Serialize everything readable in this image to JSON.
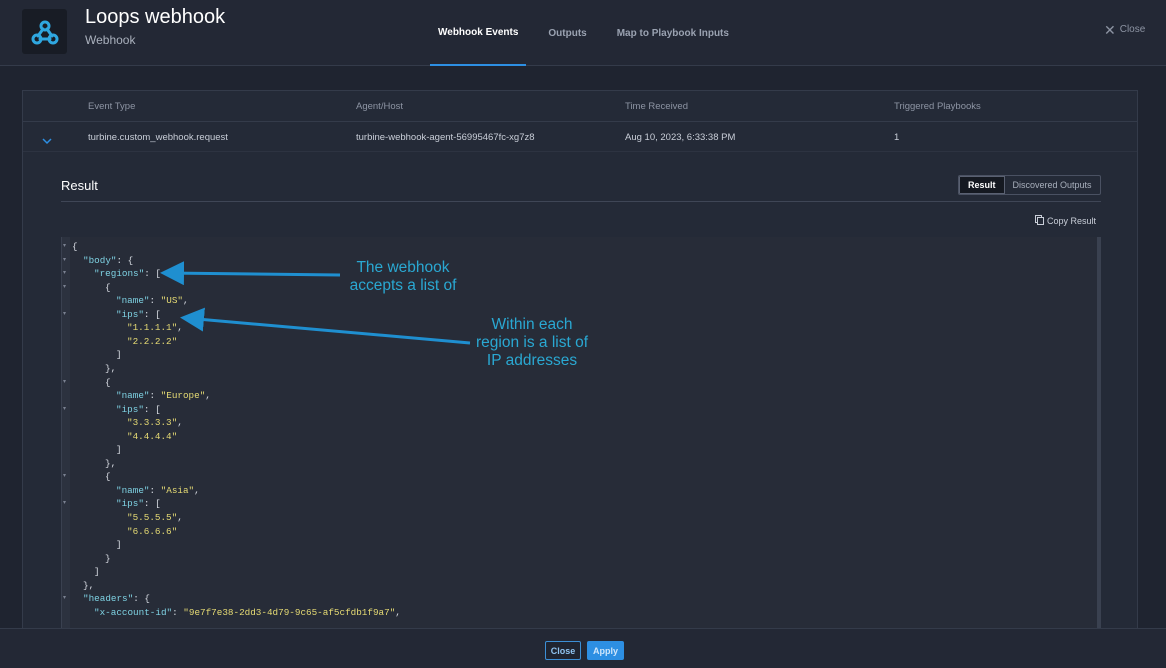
{
  "header": {
    "title": "Loops webhook",
    "subtitle": "Webhook",
    "icon": "webhook-icon",
    "tabs": [
      "Webhook Events",
      "Outputs",
      "Map to Playbook Inputs"
    ],
    "close_label": "Close"
  },
  "table": {
    "columns": [
      "Event Type",
      "Agent/Host",
      "Time Received",
      "Triggered Playbooks"
    ],
    "rows": [
      {
        "event_type": "turbine.custom_webhook.request",
        "agent_host": "turbine-webhook-agent-56995467fc-xg7z8",
        "time_received": "Aug 10, 2023, 6:33:38 PM",
        "triggered_playbooks": "1"
      }
    ]
  },
  "result": {
    "title": "Result",
    "toggle": [
      "Result",
      "Discovered Outputs"
    ],
    "copy_label": "Copy Result",
    "json_lines": [
      {
        "fold": true,
        "indent": 0,
        "parts": [
          [
            "p",
            "{"
          ]
        ]
      },
      {
        "fold": true,
        "indent": 1,
        "parts": [
          [
            "k",
            "\"body\""
          ],
          [
            "p",
            ": {"
          ]
        ]
      },
      {
        "fold": true,
        "indent": 2,
        "parts": [
          [
            "k",
            "\"regions\""
          ],
          [
            "p",
            ": ["
          ]
        ]
      },
      {
        "fold": true,
        "indent": 3,
        "parts": [
          [
            "p",
            "{"
          ]
        ]
      },
      {
        "fold": false,
        "indent": 4,
        "parts": [
          [
            "k",
            "\"name\""
          ],
          [
            "p",
            ": "
          ],
          [
            "s",
            "\"US\""
          ],
          [
            "p",
            ","
          ]
        ]
      },
      {
        "fold": true,
        "indent": 4,
        "parts": [
          [
            "k",
            "\"ips\""
          ],
          [
            "p",
            ": ["
          ]
        ]
      },
      {
        "fold": false,
        "indent": 5,
        "parts": [
          [
            "s",
            "\"1.1.1.1\""
          ],
          [
            "p",
            ","
          ]
        ]
      },
      {
        "fold": false,
        "indent": 5,
        "parts": [
          [
            "s",
            "\"2.2.2.2\""
          ]
        ]
      },
      {
        "fold": false,
        "indent": 4,
        "parts": [
          [
            "p",
            "]"
          ]
        ]
      },
      {
        "fold": false,
        "indent": 3,
        "parts": [
          [
            "p",
            "},"
          ]
        ]
      },
      {
        "fold": true,
        "indent": 3,
        "parts": [
          [
            "p",
            "{"
          ]
        ]
      },
      {
        "fold": false,
        "indent": 4,
        "parts": [
          [
            "k",
            "\"name\""
          ],
          [
            "p",
            ": "
          ],
          [
            "s",
            "\"Europe\""
          ],
          [
            "p",
            ","
          ]
        ]
      },
      {
        "fold": true,
        "indent": 4,
        "parts": [
          [
            "k",
            "\"ips\""
          ],
          [
            "p",
            ": ["
          ]
        ]
      },
      {
        "fold": false,
        "indent": 5,
        "parts": [
          [
            "s",
            "\"3.3.3.3\""
          ],
          [
            "p",
            ","
          ]
        ]
      },
      {
        "fold": false,
        "indent": 5,
        "parts": [
          [
            "s",
            "\"4.4.4.4\""
          ]
        ]
      },
      {
        "fold": false,
        "indent": 4,
        "parts": [
          [
            "p",
            "]"
          ]
        ]
      },
      {
        "fold": false,
        "indent": 3,
        "parts": [
          [
            "p",
            "},"
          ]
        ]
      },
      {
        "fold": true,
        "indent": 3,
        "parts": [
          [
            "p",
            "{"
          ]
        ]
      },
      {
        "fold": false,
        "indent": 4,
        "parts": [
          [
            "k",
            "\"name\""
          ],
          [
            "p",
            ": "
          ],
          [
            "s",
            "\"Asia\""
          ],
          [
            "p",
            ","
          ]
        ]
      },
      {
        "fold": true,
        "indent": 4,
        "parts": [
          [
            "k",
            "\"ips\""
          ],
          [
            "p",
            ": ["
          ]
        ]
      },
      {
        "fold": false,
        "indent": 5,
        "parts": [
          [
            "s",
            "\"5.5.5.5\""
          ],
          [
            "p",
            ","
          ]
        ]
      },
      {
        "fold": false,
        "indent": 5,
        "parts": [
          [
            "s",
            "\"6.6.6.6\""
          ]
        ]
      },
      {
        "fold": false,
        "indent": 4,
        "parts": [
          [
            "p",
            "]"
          ]
        ]
      },
      {
        "fold": false,
        "indent": 3,
        "parts": [
          [
            "p",
            "}"
          ]
        ]
      },
      {
        "fold": false,
        "indent": 2,
        "parts": [
          [
            "p",
            "]"
          ]
        ]
      },
      {
        "fold": false,
        "indent": 1,
        "parts": [
          [
            "p",
            "},"
          ]
        ]
      },
      {
        "fold": true,
        "indent": 1,
        "parts": [
          [
            "k",
            "\"headers\""
          ],
          [
            "p",
            ": {"
          ]
        ]
      },
      {
        "fold": false,
        "indent": 2,
        "parts": [
          [
            "k",
            "\"x-account-id\""
          ],
          [
            "p",
            ": "
          ],
          [
            "s",
            "\"9e7f7e38-2dd3-4d79-9c65-af5cfdb1f9a7\""
          ],
          [
            "p",
            ","
          ]
        ]
      }
    ]
  },
  "annotations": {
    "regions_note": [
      "The webhook",
      "accepts a list of"
    ],
    "ips_note": [
      "Within each",
      "region is a list of",
      "IP addresses"
    ]
  },
  "footer": {
    "close_label": "Close",
    "apply_label": "Apply"
  },
  "colors": {
    "accent": "#2d8fe3",
    "annotation": "#2aa8d2",
    "json_key": "#7fd3e4",
    "json_string": "#e6db74"
  }
}
